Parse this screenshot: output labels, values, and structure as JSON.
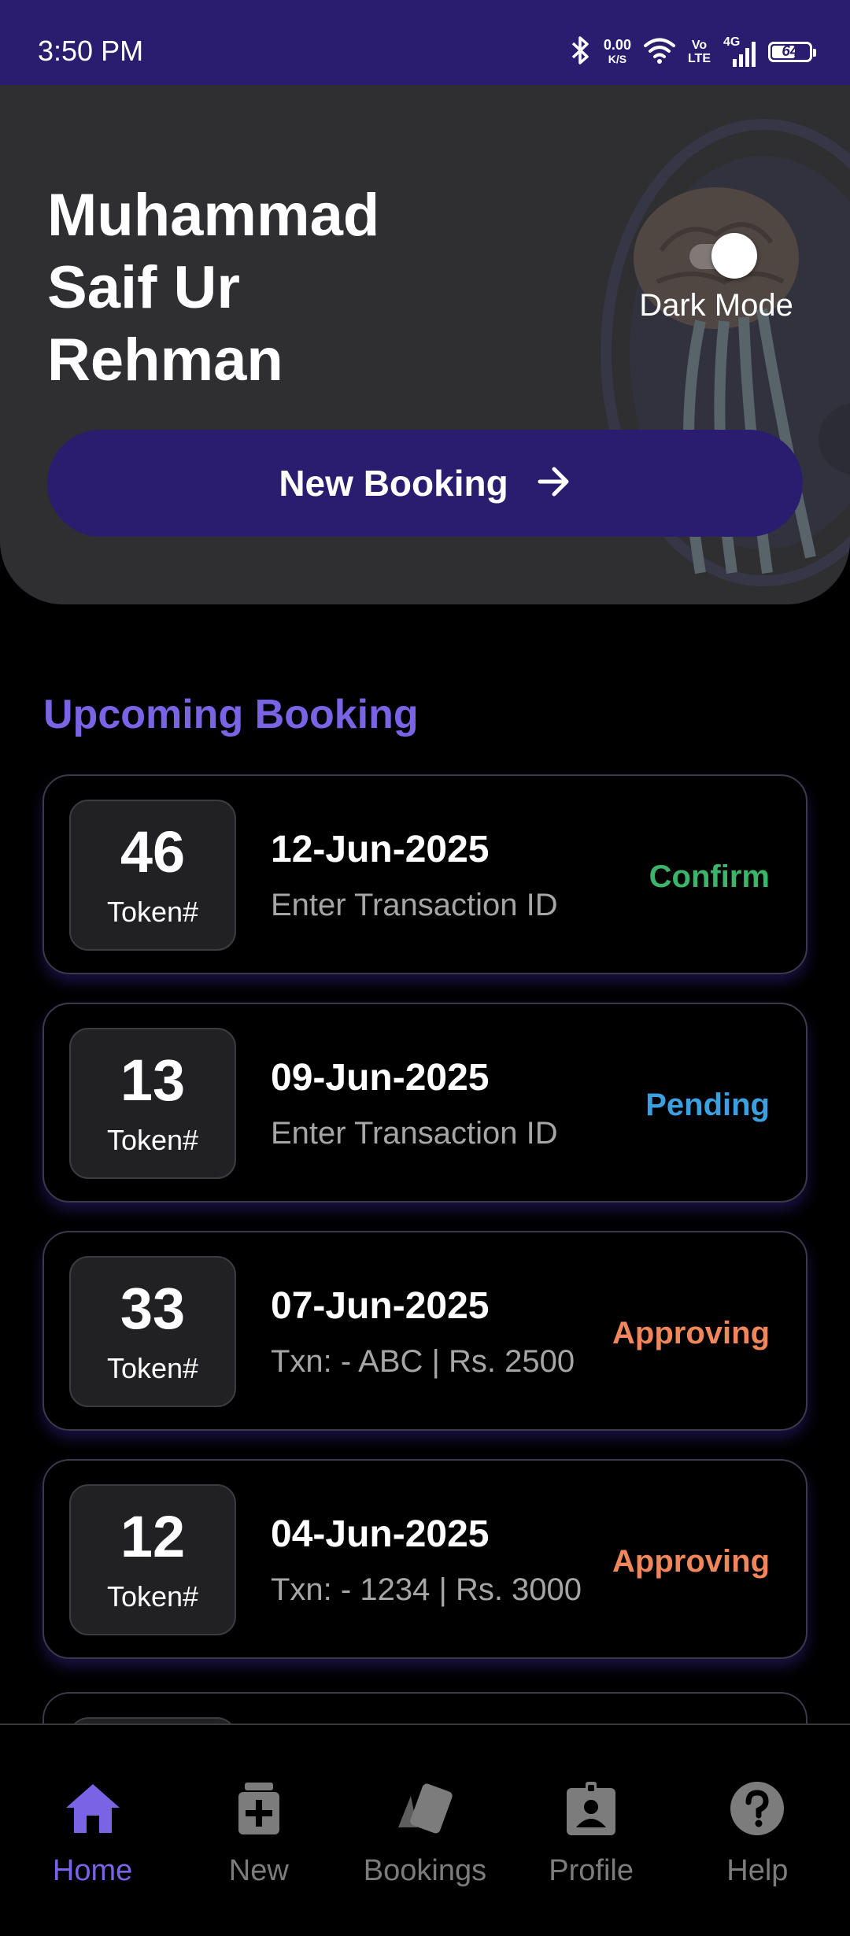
{
  "status_bar": {
    "time": "3:50 PM",
    "net_speed_value": "0.00",
    "net_speed_unit": "K/S",
    "volte_top": "Vo",
    "volte_bottom": "LTE",
    "network_type": "4G",
    "battery_level": "64",
    "battery_fraction": 0.64
  },
  "header": {
    "user_name": "Muhammad Saif Ur Rehman",
    "dark_mode_label": "Dark Mode",
    "dark_mode_on": true,
    "new_booking_label": "New Booking"
  },
  "section": {
    "title": "Upcoming Booking"
  },
  "bookings": [
    {
      "token": "46",
      "token_label": "Token#",
      "date": "12-Jun-2025",
      "txn": "Enter Transaction ID",
      "status": "Confirm",
      "status_color": "#3cb56a"
    },
    {
      "token": "13",
      "token_label": "Token#",
      "date": "09-Jun-2025",
      "txn": "Enter Transaction ID",
      "status": "Pending",
      "status_color": "#3aa0e0"
    },
    {
      "token": "33",
      "token_label": "Token#",
      "date": "07-Jun-2025",
      "txn": "Txn:  - ABC | Rs. 2500",
      "status": "Approving",
      "status_color": "#f0875a"
    },
    {
      "token": "12",
      "token_label": "Token#",
      "date": "04-Jun-2025",
      "txn": "Txn:  - 1234 | Rs. 3000",
      "status": "Approving",
      "status_color": "#f0875a"
    }
  ],
  "nav": {
    "items": [
      {
        "label": "Home",
        "icon": "home-icon",
        "active": true
      },
      {
        "label": "New",
        "icon": "medicine-add-icon",
        "active": false
      },
      {
        "label": "Bookings",
        "icon": "cards-icon",
        "active": false
      },
      {
        "label": "Profile",
        "icon": "badge-icon",
        "active": false
      },
      {
        "label": "Help",
        "icon": "help-icon",
        "active": false
      }
    ]
  },
  "colors": {
    "primary": "#2a1c6e",
    "accent": "#7b63e6",
    "header_bg": "#2f2f31",
    "inactive": "#7c7c7c"
  }
}
